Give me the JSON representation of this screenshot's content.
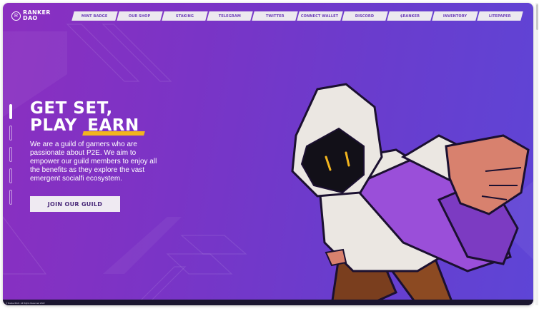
{
  "brand": {
    "line1": "RANKER",
    "line2": "DAO",
    "mark": "R"
  },
  "nav": [
    {
      "label": "MINT BADGE"
    },
    {
      "label": "OUR SHOP"
    },
    {
      "label": "STAKING"
    },
    {
      "label": "TELEGRAM"
    },
    {
      "label": "TWITTER"
    },
    {
      "label": "CONNECT WALLET"
    },
    {
      "label": "DISCORD"
    },
    {
      "label": "$RANKER"
    },
    {
      "label": "INVENTORY"
    },
    {
      "label": "LITEPAPER"
    }
  ],
  "hero": {
    "headline_line1": "GET SET,",
    "headline_line2_prefix": "PLAY",
    "headline_highlight": "EARN",
    "description": "We are a guild of gamers who are passionate about P2E. We aim to empower our guild members to enjoy all the benefits as they explore the vast emergent socialfi ecosystem.",
    "cta_label": "JOIN OUR GUILD"
  },
  "footer": {
    "text": "© RankerDAO. All Rights Reserved 2022"
  },
  "colors": {
    "accent": "#f2b51f",
    "bg_start": "#8b2fc0",
    "bg_end": "#5e45d6",
    "button_text": "#4a2a7a"
  }
}
